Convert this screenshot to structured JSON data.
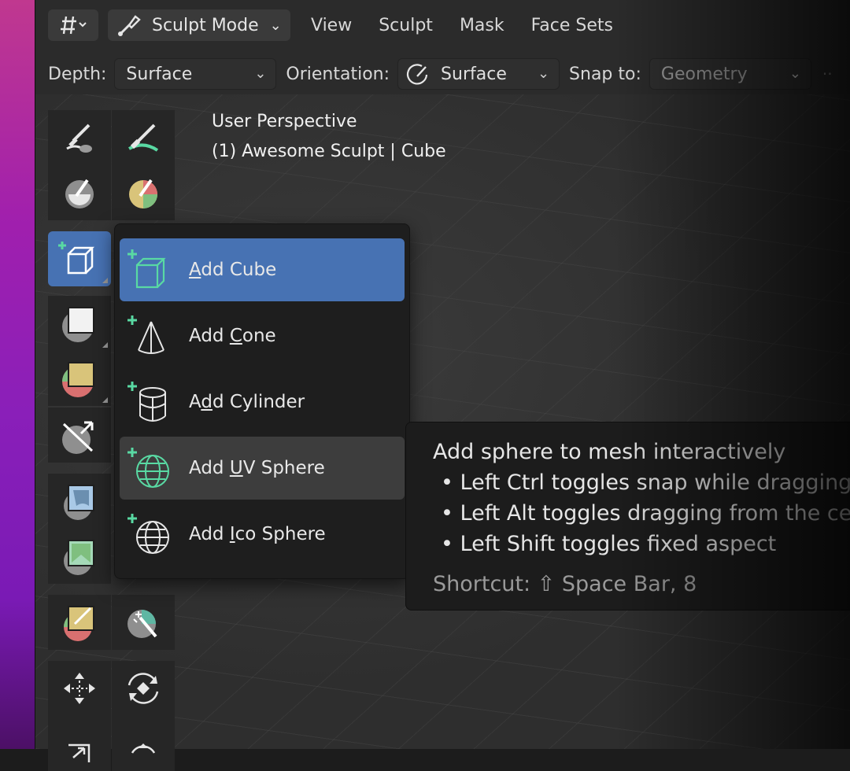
{
  "header": {
    "mode": "Sculpt Mode",
    "menus": [
      "View",
      "Sculpt",
      "Mask",
      "Face Sets"
    ]
  },
  "toolbar": {
    "depth_label": "Depth:",
    "depth_value": "Surface",
    "orientation_label": "Orientation:",
    "orientation_value": "Surface",
    "snap_label": "Snap to:",
    "snap_value": "Geometry"
  },
  "viewport": {
    "perspective": "User Perspective",
    "object": "(1) Awesome Sculpt | Cube"
  },
  "popup": {
    "items": [
      {
        "label": "Add Cube",
        "mnemonic": "A",
        "rest": "dd Cube"
      },
      {
        "label": "Add Cone",
        "pre": "Add ",
        "mnemonic": "C",
        "rest": "one"
      },
      {
        "label": "Add Cylinder",
        "pre": "A",
        "mnemonic": "d",
        "rest": "d Cylinder"
      },
      {
        "label": "Add UV Sphere",
        "pre": "Add ",
        "mnemonic": "U",
        "rest": "V Sphere"
      },
      {
        "label": "Add Ico Sphere",
        "pre": "Add ",
        "mnemonic": "I",
        "rest": "co Sphere"
      }
    ]
  },
  "tooltip": {
    "title": "Add sphere to mesh interactively",
    "bullets": [
      "Left Ctrl toggles snap while dragging",
      "Left Alt toggles dragging from the center",
      "Left Shift toggles fixed aspect"
    ],
    "shortcut": "Shortcut: ⇧ Space Bar, 8"
  },
  "colors": {
    "accent": "#4772b3",
    "add_plus": "#59d9a3"
  }
}
